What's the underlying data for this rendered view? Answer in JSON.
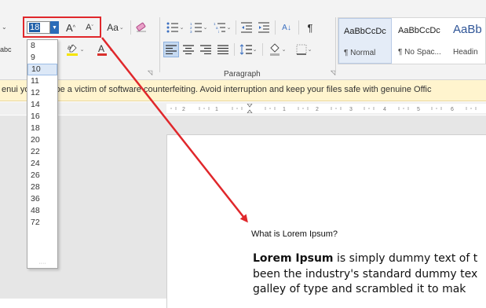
{
  "ribbon": {
    "font_size_value": "18",
    "font_size_options": [
      "8",
      "9",
      "10",
      "11",
      "12",
      "14",
      "16",
      "18",
      "20",
      "22",
      "24",
      "26",
      "28",
      "36",
      "48",
      "72"
    ],
    "grow_font_label": "A",
    "shrink_font_label": "A",
    "change_case_label": "Aa",
    "paragraph_group_label": "Paragraph",
    "left_fragment_label": "abc",
    "sort_icon_label": "A↓",
    "pilcrow_label": "¶"
  },
  "styles": [
    {
      "preview": "AaBbCcDc",
      "name": "¶ Normal"
    },
    {
      "preview": "AaBbCcDc",
      "name": "¶ No Spac..."
    },
    {
      "preview": "AaBb",
      "name": "Headin"
    }
  ],
  "warning_bar": {
    "text": "enui   you may be a victim of software counterfeiting. Avoid interruption and keep your files safe with genuine Offic"
  },
  "document": {
    "heading": "What is Lorem Ipsum?",
    "bold_lead": "Lorem Ipsum",
    "line1_rest": " is simply dummy text of t",
    "line2": "been the industry's standard dummy tex",
    "line3": "galley of type and scrambled it to mak"
  },
  "colors": {
    "highlight_red": "#e0272b",
    "selection_blue": "#2b6cb8",
    "warning_bg": "#fff4ce",
    "font_color_red": "#d9302c",
    "highlight_yellow": "#f5e400"
  }
}
